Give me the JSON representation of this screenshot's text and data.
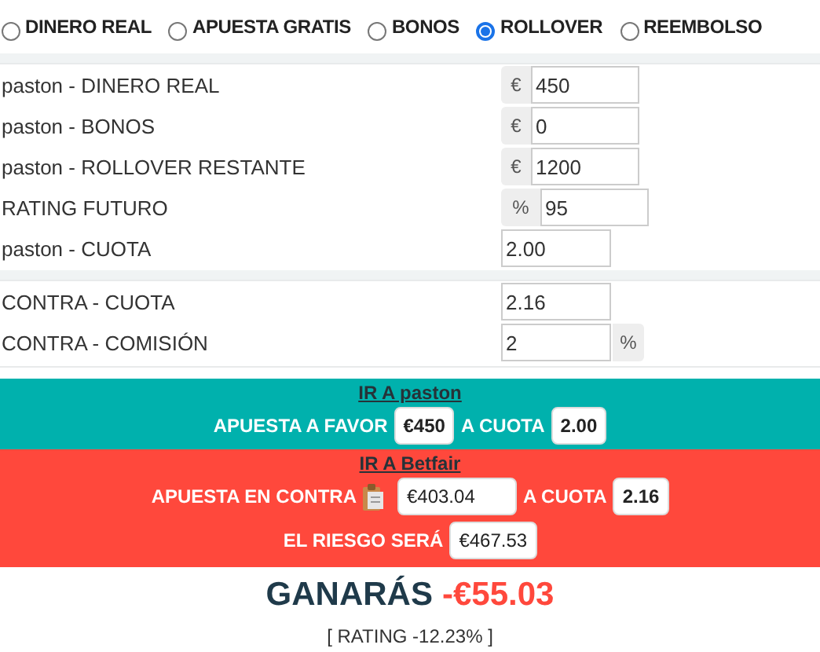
{
  "bet_types": [
    {
      "label": "DINERO REAL",
      "selected": false
    },
    {
      "label": "APUESTA GRATIS",
      "selected": false
    },
    {
      "label": "BONOS",
      "selected": false
    },
    {
      "label": "ROLLOVER",
      "selected": true
    },
    {
      "label": "REEMBOLSO",
      "selected": false
    }
  ],
  "favor_fields": [
    {
      "label": "paston - DINERO REAL",
      "prefix": "€",
      "value": "450"
    },
    {
      "label": "paston - BONOS",
      "prefix": "€",
      "value": "0"
    },
    {
      "label": "paston - ROLLOVER RESTANTE",
      "prefix": "€",
      "value": "1200"
    },
    {
      "label": "RATING FUTURO",
      "prefix": "%",
      "value": "95"
    },
    {
      "label": "paston - CUOTA",
      "value": "2.00"
    }
  ],
  "contra_fields": [
    {
      "label": "CONTRA - CUOTA",
      "value": "2.16"
    },
    {
      "label": "CONTRA - COMISIÓN",
      "value": "2",
      "suffix": "%"
    }
  ],
  "favor_panel": {
    "link": "IR A paston",
    "stake_label": "APUESTA A FAVOR",
    "stake": "€450",
    "odds_label": "A CUOTA",
    "odds": "2.00"
  },
  "contra_panel": {
    "link": "IR A Betfair",
    "stake_label": "APUESTA EN CONTRA",
    "stake": "€403.04",
    "odds_label": "A CUOTA",
    "odds": "2.16",
    "risk_label": "EL RIESGO SERÁ",
    "risk": "€467.53"
  },
  "result": {
    "label": "GANARÁS",
    "amount": "-€55.03",
    "rating": "[ RATING -12.23% ]"
  }
}
